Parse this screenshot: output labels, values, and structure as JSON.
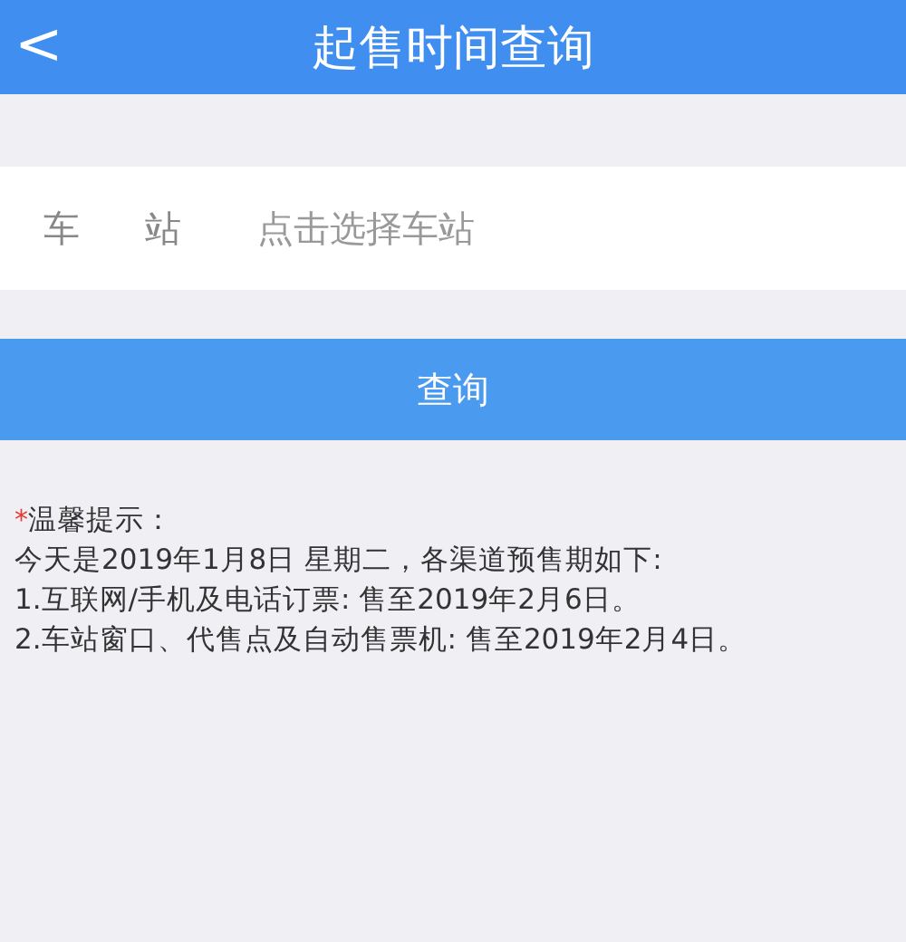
{
  "header": {
    "back": "<",
    "title": "起售时间查询"
  },
  "station": {
    "label": "车站",
    "placeholder": "点击选择车站"
  },
  "query_button": "查询",
  "notice": {
    "mark": "*",
    "title": "温馨提示：",
    "lines": [
      "今天是2019年1月8日 星期二，各渠道预售期如下:",
      "1.互联网/手机及电话订票: 售至2019年2月6日。",
      "2.车站窗口、代售点及自动售票机: 售至2019年2月4日。"
    ]
  }
}
